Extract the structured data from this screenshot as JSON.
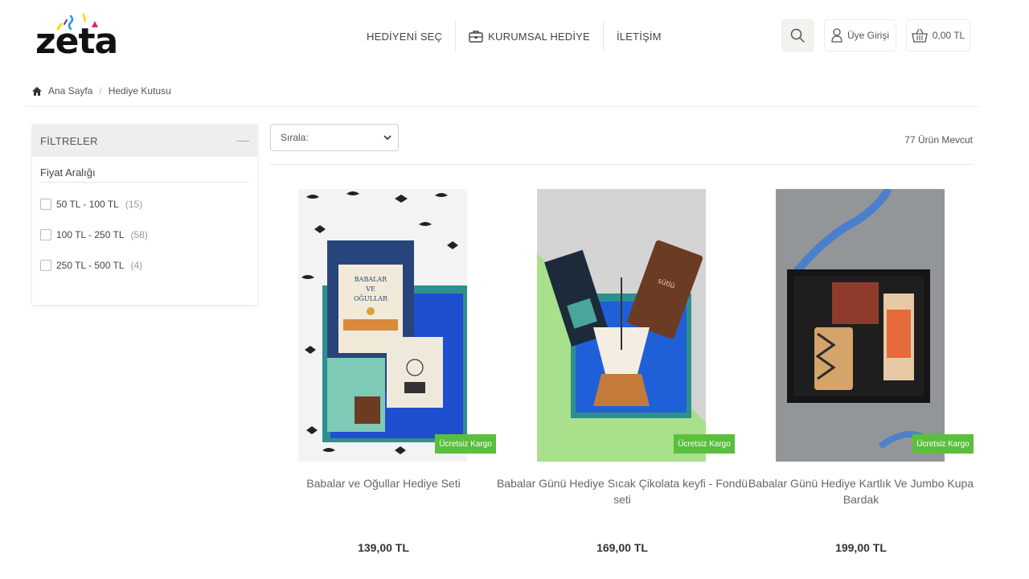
{
  "brand": {
    "logo_text": "zeta"
  },
  "nav": {
    "items": [
      {
        "label": "HEDİYENİ SEÇ"
      },
      {
        "label": "KURUMSAL HEDİYE"
      },
      {
        "label": "İLETİŞİM"
      }
    ]
  },
  "header": {
    "login_label": "Üye Girişi",
    "cart_total": "0,00 TL"
  },
  "breadcrumb": {
    "items": [
      "Ana Sayfa",
      "Hediye Kutusu"
    ],
    "separator": "/"
  },
  "filters": {
    "title": "FİLTRELER",
    "price_title": "Fiyat Aralığı",
    "options": [
      {
        "label": "50 TL - 100 TL",
        "count": "(15)"
      },
      {
        "label": "100 TL - 250 TL",
        "count": "(58)"
      },
      {
        "label": "250 TL - 500 TL",
        "count": "(4)"
      }
    ]
  },
  "toolbar": {
    "sort_label": "Sırala:",
    "product_count": "77 Ürün Mevcut"
  },
  "products": [
    {
      "title": "Babalar ve Oğullar Hediye Seti",
      "price": "139,00 TL",
      "badge": "Ücretsiz Kargo"
    },
    {
      "title": "Babalar Günü Hediye Sıcak Çikolata keyfi - Fondü seti",
      "price": "169,00 TL",
      "badge": "Ücretsiz Kargo"
    },
    {
      "title": "Babalar Günü Hediye Kartlık Ve Jumbo Kupa Bardak",
      "price": "199,00 TL",
      "badge": "Ücretsiz Kargo"
    }
  ],
  "colors": {
    "badge": "#5bbf3e",
    "filter_header_bg": "#eeeeee",
    "box_teal": "#2f8f8f",
    "logo_confetti": [
      "#e91e63",
      "#ffd600",
      "#2196f3",
      "#7b1fa2"
    ]
  },
  "icons": [
    "home-icon",
    "search-icon",
    "user-icon",
    "basket-icon",
    "briefcase-icon",
    "chevron-down-icon"
  ]
}
